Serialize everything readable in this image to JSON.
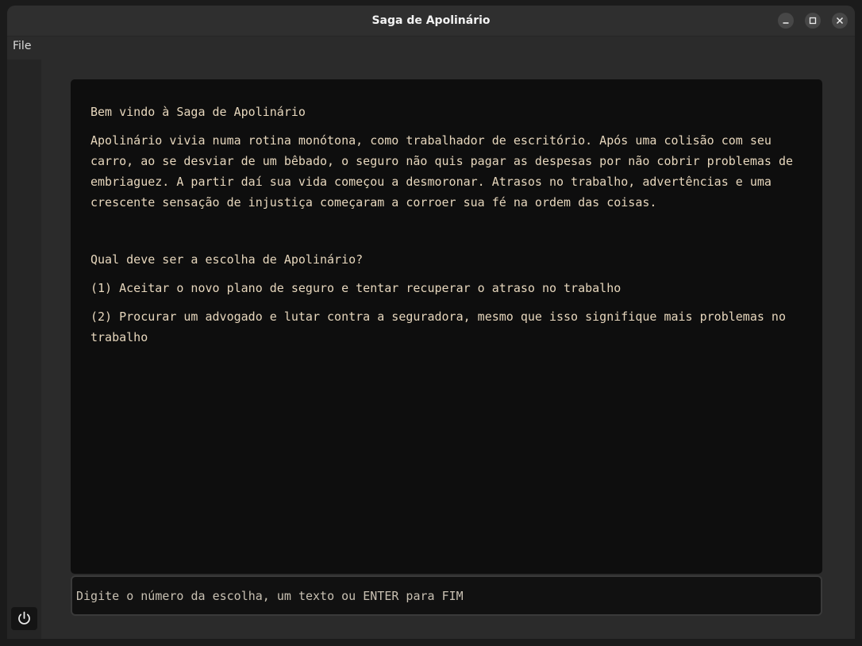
{
  "window": {
    "title": "Saga de Apolinário",
    "controls": [
      "minimize",
      "maximize",
      "close"
    ]
  },
  "menu": {
    "file_label": "File"
  },
  "sidebar": {
    "power_icon": "power-icon"
  },
  "output": {
    "heading": "Bem vindo à Saga de Apolinário",
    "story": "Apolinário vivia numa rotina monótona, como trabalhador de escritório. Após uma colisão com seu carro, ao se desviar de um bêbado, o seguro não quis pagar as despesas por não cobrir problemas de embriaguez. A partir daí sua vida começou a desmoronar. Atrasos no trabalho, advertências e uma crescente sensação de injustiça começaram a corroer sua fé na ordem das coisas.",
    "question": "Qual deve ser a escolha de Apolinário?",
    "choices": [
      "(1) Aceitar o novo plano de seguro e tentar recuperar o atraso no trabalho",
      "(2) Procurar um advogado e lutar contra a seguradora, mesmo que isso signifique mais problemas no trabalho"
    ]
  },
  "input": {
    "placeholder": "Digite o número da escolha, um texto ou ENTER para FIM",
    "value": ""
  },
  "colors": {
    "text": "#e7d7bd",
    "output_bg": "#0e0e0e",
    "window_bg": "#2b2b2b"
  }
}
